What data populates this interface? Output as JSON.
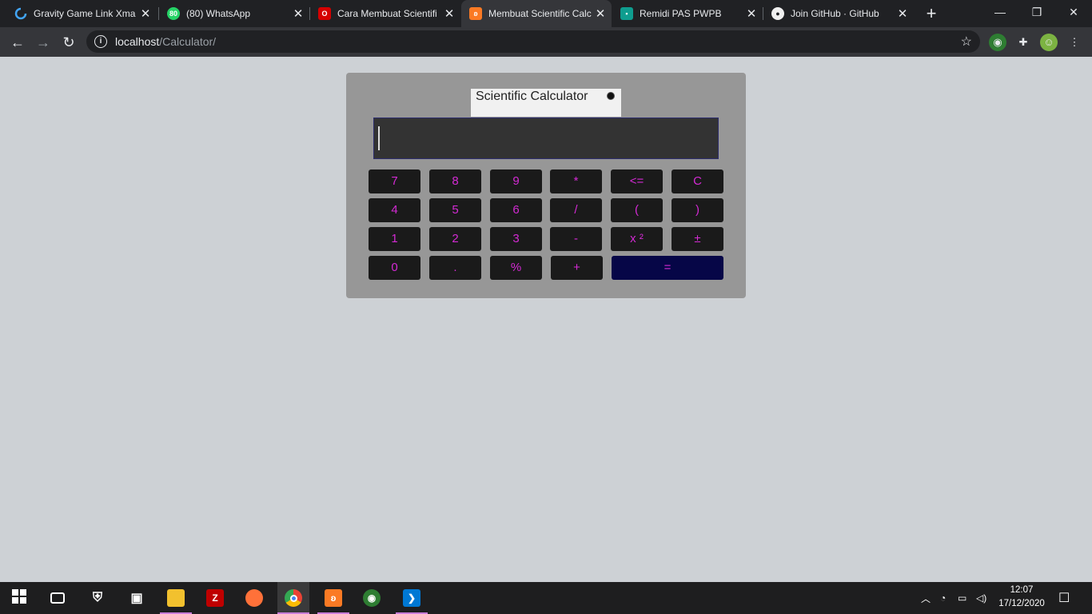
{
  "browser": {
    "tabs": [
      {
        "title": "Gravity Game Link Xma",
        "icon": "gravity-icon",
        "color": "#1e88e5"
      },
      {
        "title": "(80) WhatsApp",
        "icon": "whatsapp-icon",
        "color": "#25d366",
        "badge": "80"
      },
      {
        "title": "Cara Membuat Scientifi",
        "icon": "opera-icon",
        "color": "#d50000"
      },
      {
        "title": "Membuat Scientific Calc",
        "icon": "xampp-icon",
        "color": "#fb7a24"
      },
      {
        "title": "Remidi PAS PWPB",
        "icon": "classroom-icon",
        "color": "#0f9d8f"
      },
      {
        "title": "Join GitHub · GitHub",
        "icon": "github-icon",
        "color": "#f0f0f0"
      }
    ],
    "active_tab": 3,
    "address": {
      "host": "localhost",
      "path": "/Calculator/"
    }
  },
  "calculator": {
    "title": "Scientific Calculator",
    "display_value": "",
    "keys": [
      [
        "7",
        "8",
        "9",
        "*",
        "<=",
        "C"
      ],
      [
        "4",
        "5",
        "6",
        "/",
        "(",
        ")"
      ],
      [
        "1",
        "2",
        "3",
        "-",
        "x ²",
        "±"
      ],
      [
        "0",
        ".",
        "%",
        "+",
        "="
      ]
    ],
    "colors": {
      "key_text": "#d42ad4",
      "key_bg": "#1a1a1a",
      "equals_bg": "#060647",
      "panel": "#979797",
      "page": "#cdd1d5"
    }
  },
  "taskbar": {
    "time": "12:07",
    "date": "17/12/2020",
    "apps": [
      "start-icon",
      "task-view-icon",
      "security-icon",
      "camera-icon",
      "file-explorer-icon",
      "filezilla-icon",
      "firefox-icon",
      "chrome-icon",
      "xampp-icon",
      "globe-icon",
      "vscode-icon"
    ]
  }
}
